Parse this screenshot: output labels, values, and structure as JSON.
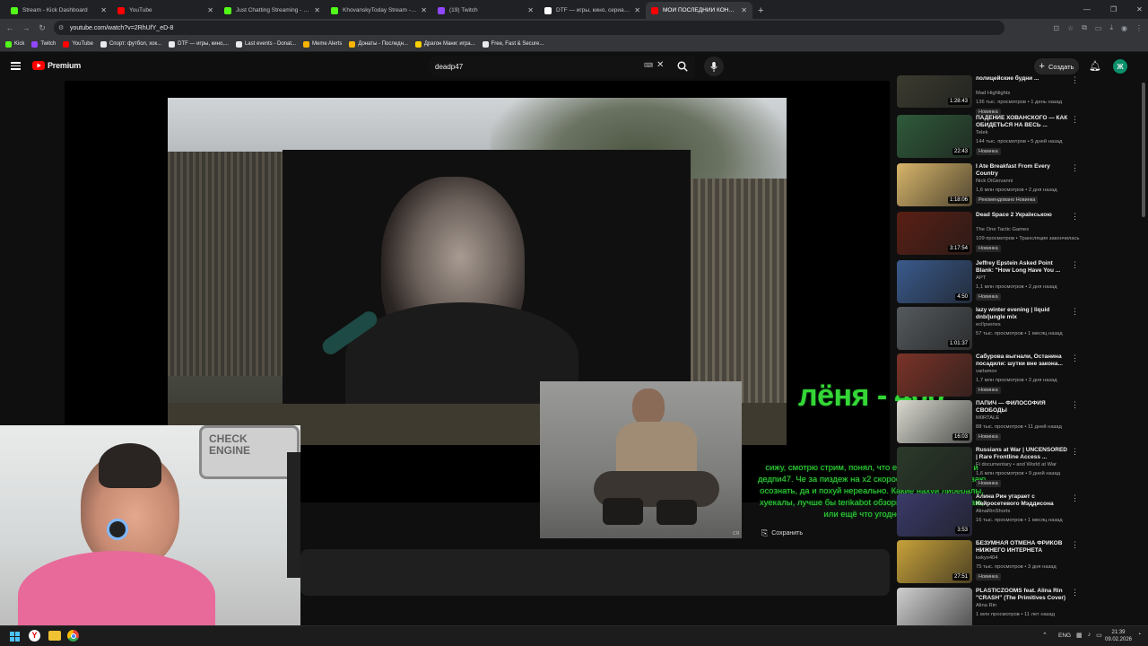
{
  "browser": {
    "tabs": [
      {
        "title": "Stream - Kick Dashboard",
        "color": "#53fc18"
      },
      {
        "title": "YouTube",
        "color": "#ff0000"
      },
      {
        "title": "Just Chatting Streaming - Live S",
        "color": "#53fc18"
      },
      {
        "title": "KhovanskyToday Stream - Watc",
        "color": "#53fc18"
      },
      {
        "title": "(19) Twitch",
        "color": "#9146ff"
      },
      {
        "title": "DTF — игры, кино, сериалы, р",
        "color": "#ffffff"
      },
      {
        "title": "МОЙ ПОСЛЕДНИЙ КОНФЛИК",
        "color": "#ff0000"
      }
    ],
    "url": "youtube.com/watch?v=2RhUfY_eD-8",
    "bookmarks": [
      {
        "label": "Kick",
        "color": "#53fc18"
      },
      {
        "label": "Twitch",
        "color": "#9146ff"
      },
      {
        "label": "YouTube",
        "color": "#ff0000"
      },
      {
        "label": "Спорт: футбол, хок...",
        "color": "#e8eaed"
      },
      {
        "label": "DTF — игры, кино,...",
        "color": "#e8eaed"
      },
      {
        "label": "Last events - Donat...",
        "color": "#e8eaed"
      },
      {
        "label": "Meme Alerts",
        "color": "#f7b500"
      },
      {
        "label": "Донаты - Последн...",
        "color": "#f7b500"
      },
      {
        "label": "Драгон Мани: игра...",
        "color": "#f7d000"
      },
      {
        "label": "Free, Fast & Secure...",
        "color": "#e8eaed"
      }
    ]
  },
  "youtube": {
    "logo_text": "Premium",
    "search_value": "deadp47",
    "create_label": "Создать",
    "avatar_letter": "Ж",
    "save_label": "Сохранить",
    "hidden_action": "ся"
  },
  "overlays": {
    "big_text": "лёня - 400",
    "donation_text": "сижу, смотрю стрим, понял, что есть какой-то бубей и дедпи47. Че за пиздеж на х2 скорости я даже не успеваю осознать, да и похуй нереально. Какие нахуй либералы, хуекалы, лучше бы terikabot обзоры навернуть, не знаю, или ещё что угодно еще"
  },
  "recommendations": [
    {
      "title": "полицейские будни ...",
      "channel": "Mad Highlights",
      "meta": "136 тыс. просмотров • 1 день назад",
      "badge": "Новинка",
      "duration": "1:28:43",
      "thumb": "#3b3b30"
    },
    {
      "title": "ПАДЕНИЕ ХОВАНСКОГО — КАК ОБИДЕТЬСЯ НА ВЕСЬ ...",
      "channel": "Telek",
      "meta": "144 тыс. просмотров • 5 дней назад",
      "badge": "Новинка",
      "duration": "22:43",
      "thumb": "#2f5a3a"
    },
    {
      "title": "I Ate Breakfast From Every Country",
      "channel": "Nick DiGiovanni",
      "meta": "1,6 млн просмотров • 2 дня назад",
      "badge": "Рекомендовано  Новинка",
      "duration": "1:18:06",
      "thumb": "#d8b56a"
    },
    {
      "title": "Dead Space 2 Українською",
      "channel": "The One Tactic Games",
      "meta": "109 просмотров • Трансляция закончилась",
      "badge": "Новинка",
      "duration": "3:17:54",
      "thumb": "#5a1f14"
    },
    {
      "title": "Jeffrey Epstein Asked Point Blank: \"How Long Have You ...",
      "channel": "APT",
      "meta": "1,1 млн просмотров • 2 дня назад",
      "badge": "Новинка",
      "duration": "4:50",
      "thumb": "#3a5a8c"
    },
    {
      "title": "lazy winter evening | liquid dnb/jungle mix",
      "channel": "ecl!pseries",
      "meta": "57 тыс. просмотров • 1 месяц назад",
      "badge": "",
      "duration": "1:01:37",
      "thumb": "#555a5e"
    },
    {
      "title": "Сабурова выгнали, Останина посадили: шутки вне закона...",
      "channel": "varlamov",
      "meta": "1,7 млн просмотров • 2 дня назад",
      "badge": "Новинка",
      "duration": "",
      "thumb": "#7a3328"
    },
    {
      "title": "ПАПИЧ — ФИЛОСОФИЯ СВОБОДЫ",
      "channel": "M0RTALE",
      "meta": "88 тыс. просмотров • 11 дней назад",
      "badge": "Новинка",
      "duration": "16:03",
      "thumb": "#d9d9d0"
    },
    {
      "title": "Russians at War | UNCENSORED | Rare Frontline Access ...",
      "channel": "Fi documentary • and World at War",
      "meta": "1,6 млн просмотров • 9 дней назад",
      "badge": "Новинка",
      "duration": "",
      "thumb": "#2b3a2a"
    },
    {
      "title": "Алина Рин угарает с Нейросетевого Мэддисона",
      "channel": "AlinaRinShorts",
      "meta": "16 тыс. просмотров • 1 месяц назад",
      "badge": "",
      "duration": "3:53",
      "thumb": "#3a3a6a"
    },
    {
      "title": "БЕЗУМНАЯ ОТМЕНА ФРИКОВ НИЖНЕГО ИНТЕРНЕТА",
      "channel": "kekys404",
      "meta": "75 тыс. просмотров • 3 дня назад",
      "badge": "Новинка",
      "duration": "27:51",
      "thumb": "#c8a23a"
    },
    {
      "title": "PLASTICZOOMS feat. Alina Rin \"CRASH\" (The Primitives Cover)",
      "channel": "Alina Rin",
      "meta": "1 млн просмотров • 11 лет назад",
      "badge": "",
      "duration": "",
      "thumb": "#cfcfcf"
    }
  ],
  "taskbar": {
    "lang": "ENG",
    "time": "21:39",
    "date": "09.02.2026"
  }
}
